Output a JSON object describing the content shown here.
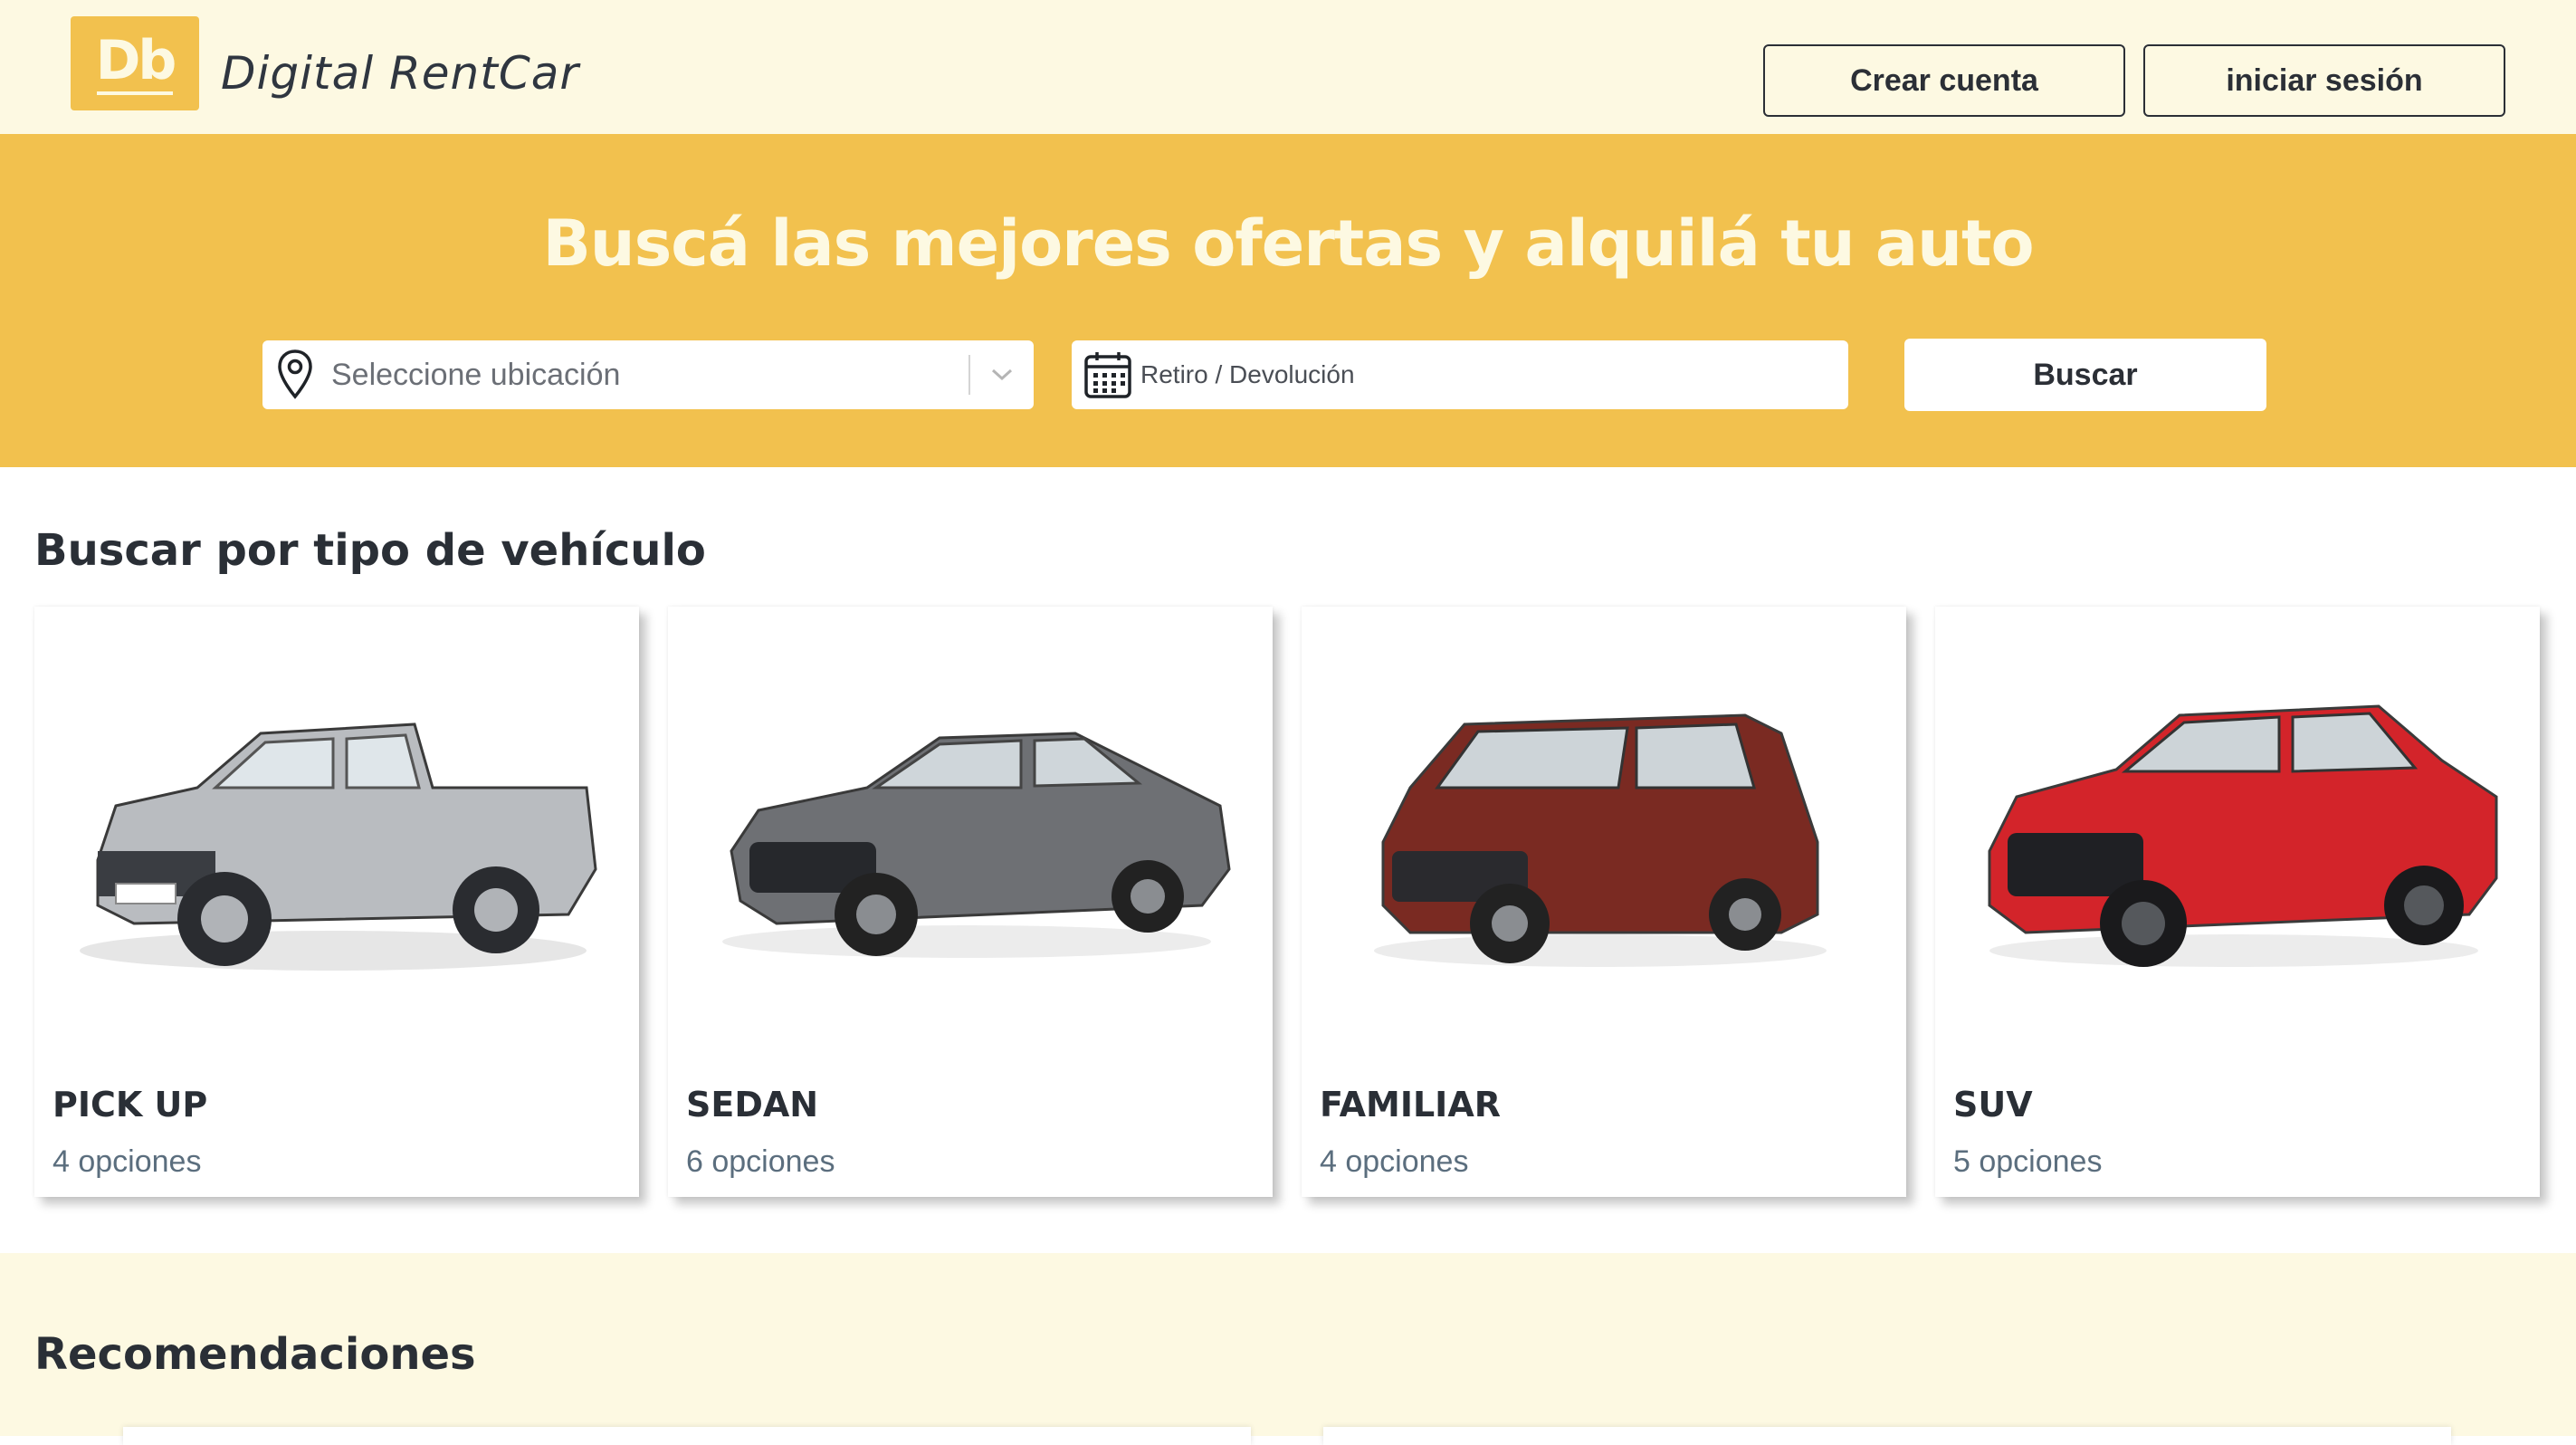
{
  "header": {
    "logo_text": "Db",
    "brand_name": "Digital RentCar",
    "create_account_label": "Crear cuenta",
    "login_label": "iniciar sesión"
  },
  "hero": {
    "title": "Buscá las mejores ofertas y alquilá tu auto",
    "location_placeholder": "Seleccione ubicación",
    "date_placeholder": "Retiro / Devolución",
    "search_label": "Buscar"
  },
  "categories": {
    "title": "Buscar por tipo de vehículo",
    "items": [
      {
        "name": "PICK UP",
        "count": "4 opciones",
        "car_color": "#b9bcc0"
      },
      {
        "name": "SEDAN",
        "count": "6 opciones",
        "car_color": "#6e7074"
      },
      {
        "name": "FAMILIAR",
        "count": "4 opciones",
        "car_color": "#7a2a22"
      },
      {
        "name": "SUV",
        "count": "5 opciones",
        "car_color": "#d3242a"
      }
    ]
  },
  "recommendations": {
    "title": "Recomendaciones"
  },
  "colors": {
    "accent": "#f2c14e",
    "cream": "#fdf9e2",
    "text_dark": "#2a2f36"
  },
  "icons": {
    "location": "map-pin-icon",
    "calendar": "calendar-icon",
    "chevron": "chevron-down-icon"
  }
}
